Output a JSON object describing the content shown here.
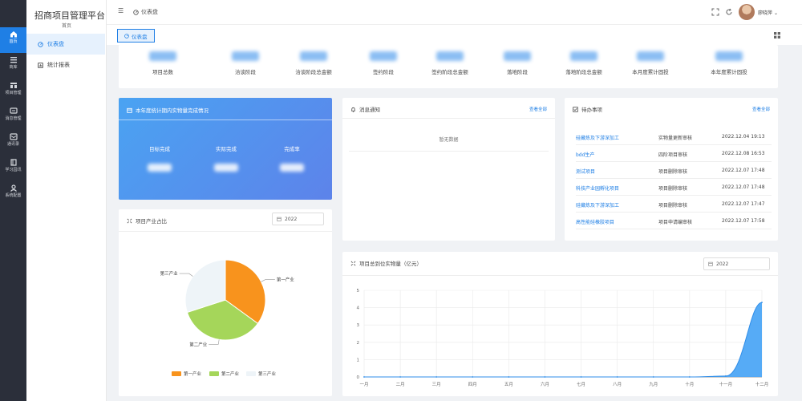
{
  "rail": [
    {
      "label": "首页",
      "icon": "home-icon"
    },
    {
      "label": "商库",
      "icon": "list-icon"
    },
    {
      "label": "项目管理",
      "icon": "project-icon"
    },
    {
      "label": "消息管理",
      "icon": "message-icon"
    },
    {
      "label": "通讯录",
      "icon": "contacts-icon"
    },
    {
      "label": "学习园讯",
      "icon": "book-icon"
    },
    {
      "label": "系统配置",
      "icon": "settings-icon"
    }
  ],
  "app_title": "招商项目管理平台",
  "app_subtitle": "首页",
  "menu": [
    {
      "label": "仪表盘",
      "icon": "dashboard-icon"
    },
    {
      "label": "统计报表",
      "icon": "report-icon"
    }
  ],
  "header": {
    "crumb": "仪表盘",
    "user": "廖晓萍"
  },
  "tab": "仪表盘",
  "stats": [
    "项目总数",
    "洽谈阶段",
    "洽谈阶段总金额",
    "签约阶段",
    "签约阶段总金额",
    "落地阶段",
    "落地阶段总金额",
    "本月度累计固投",
    "本年度累计固投"
  ],
  "blue": {
    "title": "本年度统计期内实物量完成情况",
    "cols": [
      "目标完成",
      "实际完成",
      "完成率"
    ]
  },
  "notice": {
    "title": "消息通知",
    "link": "查看全部",
    "empty": "暂无数据"
  },
  "todo": {
    "title": "待办事项",
    "link": "查看全部",
    "rows": [
      {
        "name": "硅藏炼及下游深加工",
        "type": "实物量更新审核",
        "time": "2022.12.04 19:13"
      },
      {
        "name": "bdd生产",
        "type": "四阶项目审核",
        "time": "2022.12.08 16:53"
      },
      {
        "name": "测试项目",
        "type": "项目删除审核",
        "time": "2022.12.07 17:48"
      },
      {
        "name": "科技产业园孵化项目",
        "type": "项目删除审核",
        "time": "2022.12.07 17:48"
      },
      {
        "name": "硅藏炼及下游深加工",
        "type": "项目删除审核",
        "time": "2022.12.07 17:47"
      },
      {
        "name": "高性能硅橡胶项目",
        "type": "项目申请编审核",
        "time": "2022.12.07 17:58"
      }
    ]
  },
  "pie_card": {
    "title": "项目产业占比",
    "year": "2022"
  },
  "line_card": {
    "title": "项目总到位实物量（亿元）",
    "year": "2022"
  },
  "chart_data": [
    {
      "type": "pie",
      "categories": [
        "第一产业",
        "第二产业",
        "第三产业"
      ],
      "values": [
        35,
        35,
        30
      ],
      "colors": [
        "#f8931d",
        "#a5d65a",
        "#eef4f8"
      ],
      "legend_position": "bottom"
    },
    {
      "type": "area",
      "categories": [
        "一月",
        "二月",
        "三月",
        "四月",
        "五月",
        "六月",
        "七月",
        "八月",
        "九月",
        "十月",
        "十一月",
        "十二月"
      ],
      "values": [
        0,
        0,
        0,
        0,
        0,
        0,
        0,
        0,
        0,
        0,
        0.05,
        4.3
      ],
      "ylim": [
        0,
        5
      ],
      "yticks": [
        0,
        1,
        2,
        3,
        4,
        5
      ],
      "grid": true,
      "color": "#4da6f5"
    }
  ]
}
